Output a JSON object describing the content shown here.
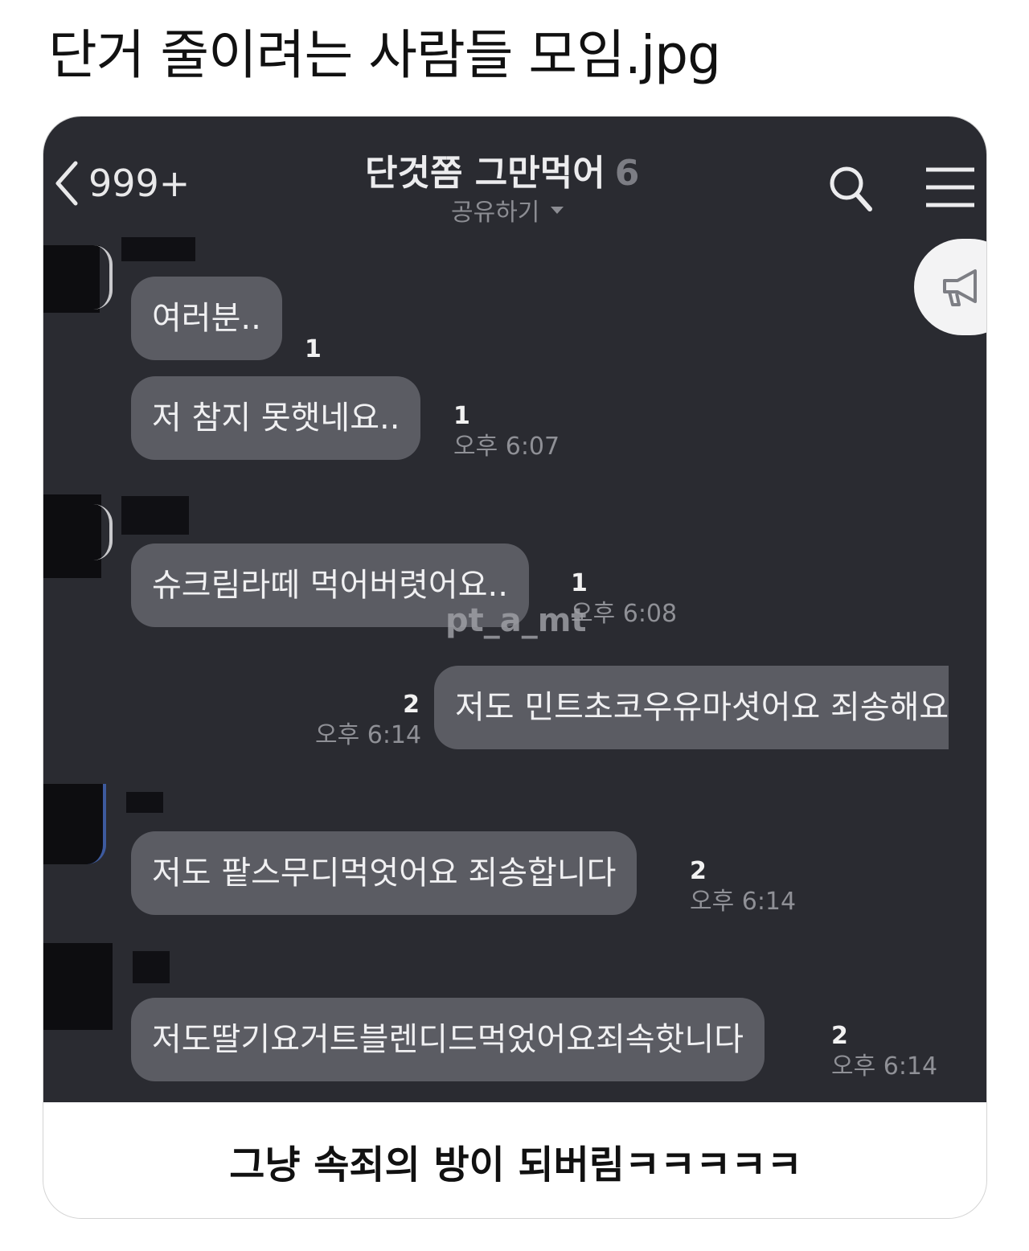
{
  "post": {
    "title": "단거 줄이려는 사람들 모임.jpg"
  },
  "chat": {
    "back_count": "999+",
    "room_name": "단것쫌 그만먹어",
    "member_count": "6",
    "share_label": "공유하기",
    "watermark": "pt_a_mt",
    "messages": [
      {
        "text": "여러분..",
        "unread": "1",
        "time": ""
      },
      {
        "text": "저 참지 못햇네요..",
        "unread": "1",
        "time": "오후 6:07"
      },
      {
        "text": "슈크림라떼 먹어버렷어요..",
        "unread": "1",
        "time": "오후 6:08"
      },
      {
        "text": "저도 민트초코우유마셧어요 죄송해요",
        "unread": "2",
        "time": "오후 6:14"
      },
      {
        "text": "저도 팥스무디먹엇어요 죄송합니다",
        "unread": "2",
        "time": "오후 6:14"
      },
      {
        "text": "저도딸기요거트블렌디드먹었어요죄속핫니다",
        "unread": "2",
        "time": "오후 6:14"
      }
    ]
  },
  "caption": "그냥 속죄의 방이 되버림ㅋㅋㅋㅋㅋ",
  "colors": {
    "chat_background": "#2a2b31",
    "bubble": "#5b5c63",
    "bubble_text": "#f0f0f2"
  },
  "icons": [
    "chevron-left-icon",
    "search-icon",
    "menu-icon",
    "megaphone-icon",
    "caret-down-icon"
  ]
}
